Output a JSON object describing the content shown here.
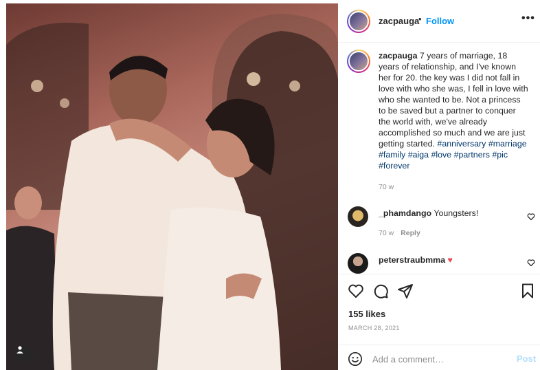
{
  "header": {
    "username": "zacpauga",
    "separator": "•",
    "follow_label": "Follow",
    "more_label": "•••"
  },
  "caption": {
    "username": "zacpauga",
    "text": " 7 years of marriage, 18 years of relationship, and I've known her for 20. the key was I did not fall in love with who she was, I fell in love with who she wanted to be. Not a princess to be saved but a partner to conquer the world with, we've already accomplished so much and we are just getting started. ",
    "hashtags": [
      "#anniversary",
      "#marriage",
      "#family",
      "#aiga",
      "#love",
      "#partners",
      "#pic",
      "#forever"
    ],
    "time": "70 w"
  },
  "comments": [
    {
      "username": "_phamdango",
      "text": "Youngsters!",
      "time": "70 w",
      "reply_label": "Reply"
    },
    {
      "username": "peterstraubmma",
      "text": "♥"
    }
  ],
  "footer": {
    "likes": "155 likes",
    "date": "MARCH 28, 2021",
    "comment_placeholder": "Add a comment…",
    "post_label": "Post"
  },
  "icons": {
    "like": "heart-icon",
    "comment": "comment-icon",
    "share": "share-icon",
    "save": "bookmark-icon",
    "emoji": "emoji-icon",
    "tag": "user-tag-icon"
  },
  "colors": {
    "follow": "#0095f6",
    "hashtag": "#00376b",
    "muted": "#8e8e8e",
    "post_disabled": "#b2dffc",
    "heart_red": "#ed4956"
  }
}
